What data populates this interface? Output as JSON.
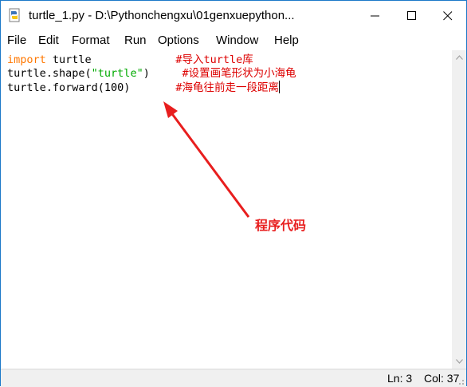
{
  "window": {
    "title": "turtle_1.py - D:\\Pythonchengxu\\01genxuepython...",
    "icons": {
      "app": "python-file-icon",
      "minimize": "minimize-icon",
      "maximize": "maximize-icon",
      "close": "close-icon"
    }
  },
  "menu": {
    "items": [
      "File",
      "Edit",
      "Format",
      "Run",
      "Options",
      "Window",
      "Help"
    ]
  },
  "editor": {
    "lines": [
      {
        "kw": "import",
        "code": " turtle",
        "pad": "             ",
        "comment": "#导入turtle库"
      },
      {
        "code1": "turtle.shape(",
        "str": "\"turtle\"",
        "code2": ")",
        "pad": "     ",
        "comment": "#设置画笔形状为小海龟"
      },
      {
        "code": "turtle.forward(100)",
        "pad": "       ",
        "comment": "#海龟往前走一段距离"
      }
    ]
  },
  "annotation": {
    "label": "程序代码",
    "color": "#e81e1e"
  },
  "status": {
    "line": "Ln: 3",
    "col": "Col: 37"
  },
  "colors": {
    "keyword": "#ff7700",
    "string": "#00aa00",
    "comment": "#dd0000",
    "border": "#1c79c9"
  }
}
